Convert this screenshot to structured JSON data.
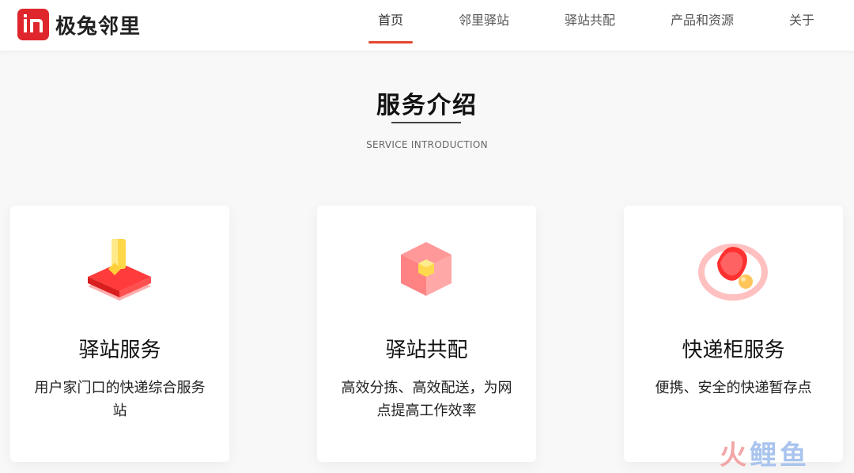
{
  "brand": {
    "name": "极兔邻里",
    "logo_letters": "In",
    "color": "#e0262d"
  },
  "nav": {
    "items": [
      {
        "label": "首页",
        "active": true
      },
      {
        "label": "邻里驿站",
        "active": false
      },
      {
        "label": "驿站共配",
        "active": false
      },
      {
        "label": "产品和资源",
        "active": false
      },
      {
        "label": "关于",
        "active": false
      }
    ],
    "accent": "#e5462f"
  },
  "section": {
    "title": "服务介绍",
    "subtitle": "SERVICE INTRODUCTION"
  },
  "cards": [
    {
      "icon": "package-station-icon",
      "title": "驿站服务",
      "desc": "用户家门口的快递综合服务站"
    },
    {
      "icon": "cube-distribution-icon",
      "title": "驿站共配",
      "desc": "高效分拣、高效配送，为网点提高工作效率"
    },
    {
      "icon": "locker-safe-icon",
      "title": "快递柜服务",
      "desc": "便携、安全的快递暂存点"
    }
  ],
  "watermark": {
    "chars": [
      "火",
      "鲤",
      "鱼"
    ]
  }
}
